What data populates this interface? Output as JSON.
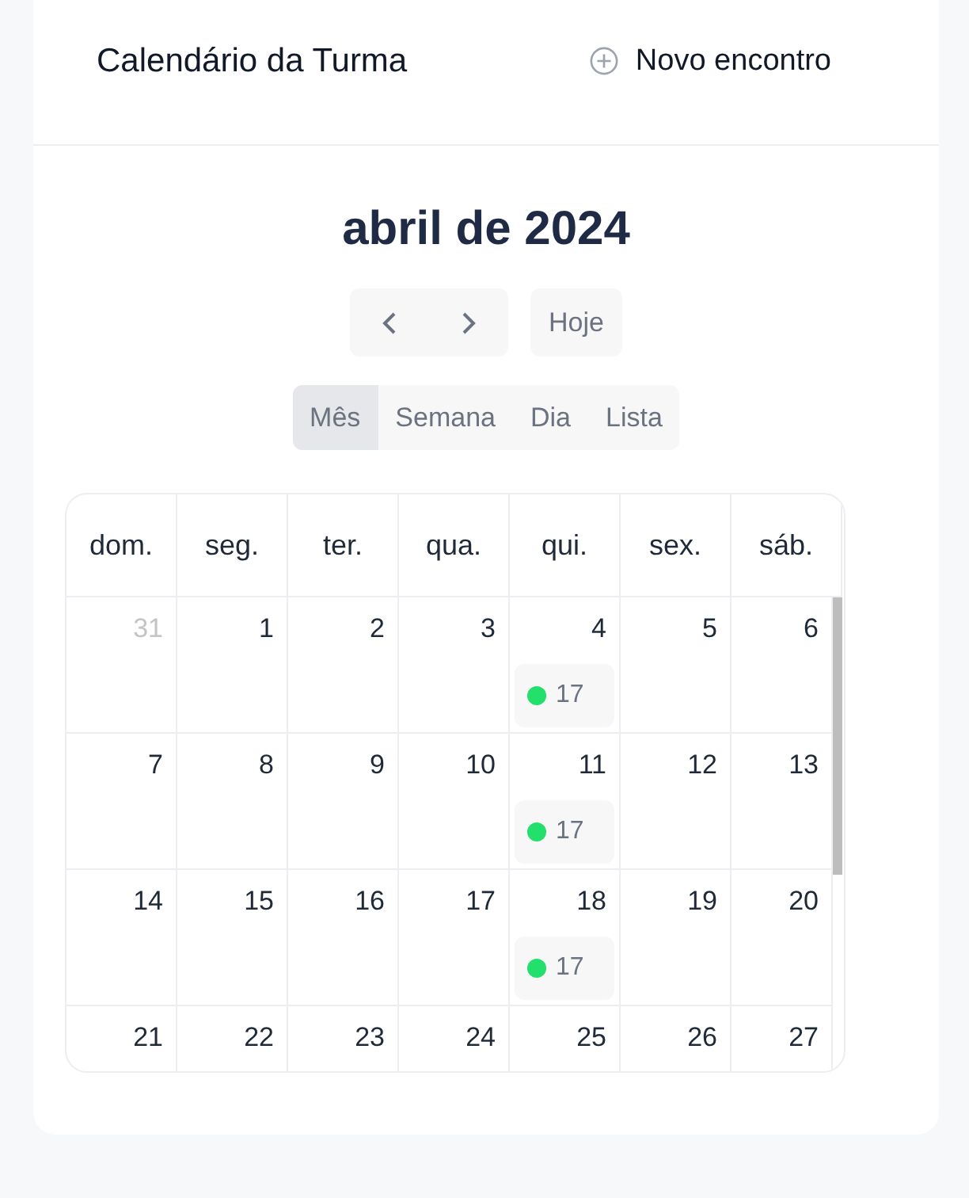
{
  "header": {
    "title": "Calendário da Turma",
    "new_button": "Novo encontro"
  },
  "calendar": {
    "title": "abril de 2024",
    "today_button": "Hoje",
    "views": [
      {
        "label": "Mês",
        "selected": true
      },
      {
        "label": "Semana",
        "selected": false
      },
      {
        "label": "Dia",
        "selected": false
      },
      {
        "label": "Lista",
        "selected": false
      }
    ],
    "weekdays": [
      "dom.",
      "seg.",
      "ter.",
      "qua.",
      "qui.",
      "sex.",
      "sáb."
    ],
    "weeks": [
      [
        {
          "day": "31",
          "outside": true
        },
        {
          "day": "1",
          "outside": false
        },
        {
          "day": "2",
          "outside": false
        },
        {
          "day": "3",
          "outside": false
        },
        {
          "day": "4",
          "outside": false,
          "events": [
            {
              "time": "17",
              "color": "#22e06b"
            }
          ]
        },
        {
          "day": "5",
          "outside": false
        },
        {
          "day": "6",
          "outside": false
        }
      ],
      [
        {
          "day": "7",
          "outside": false
        },
        {
          "day": "8",
          "outside": false
        },
        {
          "day": "9",
          "outside": false
        },
        {
          "day": "10",
          "outside": false
        },
        {
          "day": "11",
          "outside": false,
          "events": [
            {
              "time": "17",
              "color": "#22e06b"
            }
          ]
        },
        {
          "day": "12",
          "outside": false
        },
        {
          "day": "13",
          "outside": false
        }
      ],
      [
        {
          "day": "14",
          "outside": false
        },
        {
          "day": "15",
          "outside": false
        },
        {
          "day": "16",
          "outside": false
        },
        {
          "day": "17",
          "outside": false
        },
        {
          "day": "18",
          "outside": false,
          "events": [
            {
              "time": "17",
              "color": "#22e06b"
            }
          ]
        },
        {
          "day": "19",
          "outside": false
        },
        {
          "day": "20",
          "outside": false
        }
      ],
      [
        {
          "day": "21",
          "outside": false
        },
        {
          "day": "22",
          "outside": false
        },
        {
          "day": "23",
          "outside": false
        },
        {
          "day": "24",
          "outside": false
        },
        {
          "day": "25",
          "outside": false
        },
        {
          "day": "26",
          "outside": false
        },
        {
          "day": "27",
          "outside": false
        }
      ]
    ]
  }
}
